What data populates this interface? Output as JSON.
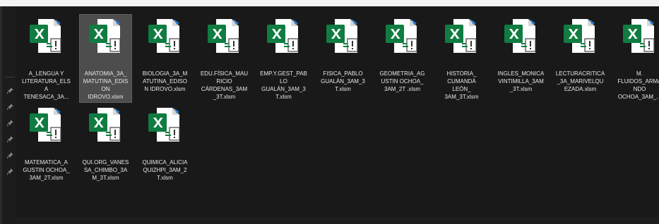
{
  "explorer": {
    "view": "large-icons",
    "accent_excel": "#107c41",
    "files": [
      {
        "name": "A_LENGUA Y\nLITERATURA_ELS\nA\nTENESACA_3A...",
        "icon": "excel-macro-file-icon",
        "selected": false
      },
      {
        "name": "ANATOMIA_3A_\nMATUTINA_EDIS\nON\nIDROVO.xlsm",
        "icon": "excel-macro-file-icon",
        "selected": true
      },
      {
        "name": "BIOLOGIA_3A_M\nATUTINA_EDISO\nN IDROVO.xlsm",
        "icon": "excel-macro-file-icon",
        "selected": false
      },
      {
        "name": "EDU.FÍSICA_MAU\nRICIO\nCÁRDENAS_3AM\n_3T.xlsm",
        "icon": "excel-macro-file-icon",
        "selected": false
      },
      {
        "name": "EMP.Y.GEST_PAB\nLO\nGUALÁN_3AM_3\nT.xlsm",
        "icon": "excel-macro-file-icon",
        "selected": false
      },
      {
        "name": "FISICA_PABLO\nGUALÁN_3AM_3\nT.xlsm",
        "icon": "excel-macro-file-icon",
        "selected": false
      },
      {
        "name": "GEOMETRIA_AG\nUSTIN OCHOA_\n3AM_2T .xlsm",
        "icon": "excel-macro-file-icon",
        "selected": false
      },
      {
        "name": "HISTORIA_\nCUMANDÁ\nLEÓN_\n3AM_3T.xlsm",
        "icon": "excel-macro-file-icon",
        "selected": false
      },
      {
        "name": "INGLES_MONICA\nVINTIMILLA_3AM\n_3T.xlsm",
        "icon": "excel-macro-file-icon",
        "selected": false
      },
      {
        "name": "LECTURACRITICA\n_3A_MARIVELQU\nEZADA.xlsm",
        "icon": "excel-macro-file-icon",
        "selected": false
      },
      {
        "name": "M.\nFLUIDOS_ARMA\nNDO\nOCHOA_3AM_...",
        "icon": "excel-macro-file-icon",
        "selected": false
      },
      {
        "name": "MATEMATICA_A\nGUSTIN OCHOA_\n3AM_2T.xlsm",
        "icon": "excel-macro-file-icon",
        "selected": false
      },
      {
        "name": "QUI.ORG_VANES\nSA_CHIMBO_3A\nM_3T.xlsm",
        "icon": "excel-macro-file-icon",
        "selected": false
      },
      {
        "name": "QUIMICA_ALICIA\nQUIZHPI_3AM_2\nT.xlsm",
        "icon": "excel-macro-file-icon",
        "selected": false
      }
    ],
    "nav_pins": [
      "pin-icon",
      "pin-icon",
      "pin-icon",
      "pin-icon",
      "pin-icon",
      "pin-icon"
    ]
  }
}
